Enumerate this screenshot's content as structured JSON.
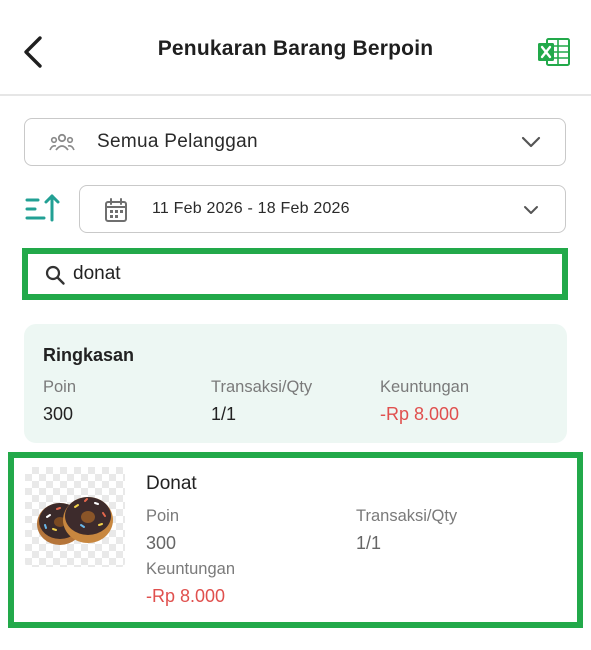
{
  "header": {
    "title": "Penukaran Barang Berpoin",
    "back_icon": "chevron-left-icon",
    "export_icon": "excel-icon"
  },
  "filters": {
    "customer": {
      "label": "Semua Pelanggan",
      "icon": "people-icon"
    },
    "sort_icon": "sort-ascending-icon",
    "date_range": {
      "label": "11 Feb 2026 - 18 Feb 2026",
      "icon": "calendar-icon"
    }
  },
  "search": {
    "value": "donat",
    "placeholder": ""
  },
  "summary": {
    "title": "Ringkasan",
    "points_label": "Poin",
    "points_value": "300",
    "transactions_label": "Transaksi/Qty",
    "transactions_value": "1/1",
    "profit_label": "Keuntungan",
    "profit_value": "-Rp 8.000"
  },
  "items": [
    {
      "name": "Donat",
      "image": "donut-image",
      "points_label": "Poin",
      "points_value": "300",
      "transactions_label": "Transaksi/Qty",
      "transactions_value": "1/1",
      "profit_label": "Keuntungan",
      "profit_value": "-Rp 8.000"
    }
  ],
  "colors": {
    "accent_green": "#22a94a",
    "negative_red": "#e0504e",
    "summary_bg": "#edf7f3"
  }
}
